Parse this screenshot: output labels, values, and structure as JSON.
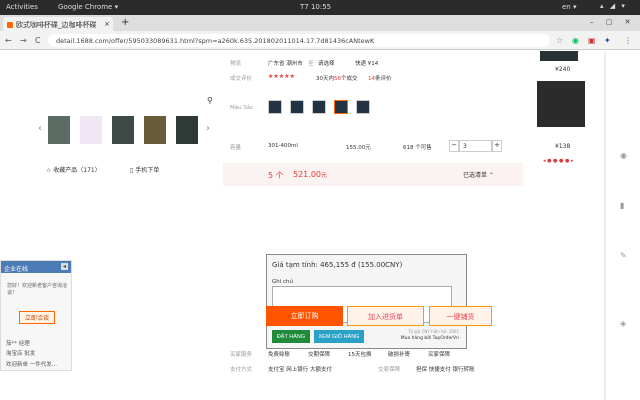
{
  "os": {
    "activities": "Activities",
    "app": "Google Chrome ▾",
    "clock": "T7 10:55",
    "lang": "en ▾",
    "tray": "▴ ◢ ▾"
  },
  "browser": {
    "tab_title": "欧式咖啡杯碟_边咖啡杯碟",
    "tab_close": "×",
    "new_tab": "+",
    "window_controls": "– ▢ ✕",
    "back": "←",
    "forward": "→",
    "reload": "C",
    "lock": "🔒",
    "url": "detail.1688.com/offer/595033089631.html?spm=a260k.635.201802011014.17.7d81436cANtewK"
  },
  "product": {
    "logistics_label": "物流",
    "from": "广东省 潮州市",
    "to_sep": "至",
    "to": "请选择",
    "shipping": "快递 ¥14",
    "rating_label": "成交评价",
    "stars": "★★★★★",
    "deals_prefix": "30天内",
    "deals_count": "56",
    "deals_suffix": "个成交",
    "reviews_count": "14",
    "reviews_label": "条评价",
    "color_label": "Màu Sắc",
    "qty_label": "容量",
    "variant": "301-400ml",
    "price": "155.00元",
    "stock": "618 个可售",
    "qty": "3",
    "minus": "−",
    "plus": "+",
    "total_count": "5 个",
    "total_price": "521.00",
    "total_unit": "元",
    "selected": "已选清单 ⌃",
    "collect": "☆ 收藏产品（171）",
    "mobile": "▯ 手机下单",
    "prev_arrow": "‹",
    "next_arrow": "›",
    "zoom": "⚲"
  },
  "order_tool": {
    "total": "Giá tạm tính: 465,155 đ (155.00CNY)",
    "note_label": "Ghi chú",
    "order_btn": "ĐẶT HÀNG",
    "cart_btn": "XEM GIỎ HÀNG",
    "rate_note": "Tỷ giá CNY hiện tại: 3001",
    "by": "Mua hàng bởi TopOrderVn"
  },
  "actions": {
    "buy": "立即订购",
    "add": "加入进货单",
    "one_click": "一键铺货"
  },
  "services": {
    "label": "买家服务",
    "items": [
      "免费赊账",
      "交期保障",
      "15天包换",
      "破损补寄",
      "买家保障"
    ],
    "pay_label": "支付方式",
    "pay": "支付宝  网上银行  大额支付",
    "guarantee_label": "交易保障",
    "guarantee": "担保  快捷支付  银行转账"
  },
  "side_chat": {
    "header": "企业在线",
    "collapse": "◂",
    "msg": "您好！欢迎新老客户咨询洽谈！",
    "ask_btn": "立即洽谈",
    "l1": "茄** 经理",
    "l2": "淘宝店 批发",
    "l3": "欢迎新单  一件代发..."
  },
  "recs": {
    "price1": "¥240",
    "price2": "¥138",
    "dots": "◂ ● ● ● ●  ▸"
  }
}
